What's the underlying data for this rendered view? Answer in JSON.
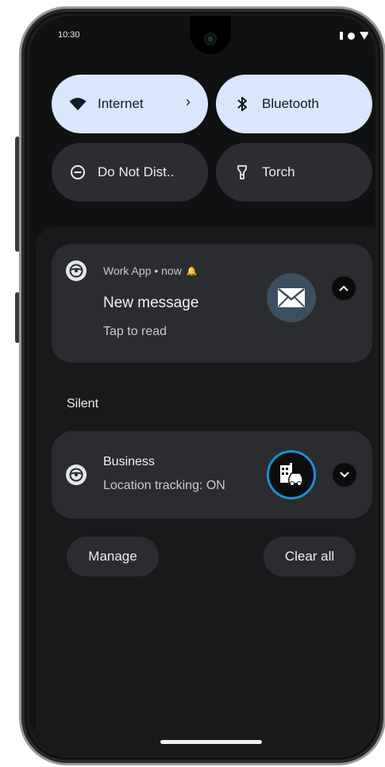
{
  "status_bar": {
    "time": "10:30"
  },
  "quick_settings": [
    {
      "label": "Internet",
      "icon": "wifi-icon",
      "active": true,
      "has_chevron": true
    },
    {
      "label": "Bluetooth",
      "icon": "bluetooth-icon",
      "active": true
    },
    {
      "label": "Do Not Dist..",
      "icon": "do-not-disturb-icon",
      "active": false
    },
    {
      "label": "Torch",
      "icon": "flashlight-icon",
      "active": false
    }
  ],
  "notifications": [
    {
      "app": "Work App",
      "meta": "Work App • now",
      "title": "New message",
      "text": "Tap to read",
      "large_icon": "mail-icon",
      "expanded": true
    }
  ],
  "silent_section": {
    "header": "Silent",
    "notifications": [
      {
        "title": "Business",
        "text": "Location tracking: ON",
        "large_icon": "building-car-icon",
        "expanded": false
      }
    ]
  },
  "actions": {
    "manage": "Manage",
    "clear_all": "Clear all"
  },
  "colors": {
    "screen_bg": "#0f1113",
    "tile_active": "#d9e6fb",
    "tile_inactive": "#2c2d30",
    "card_bg": "#2b2c2f",
    "mail_icon_bg": "#3b4f60",
    "accent_ring": "#1a8fd6"
  }
}
